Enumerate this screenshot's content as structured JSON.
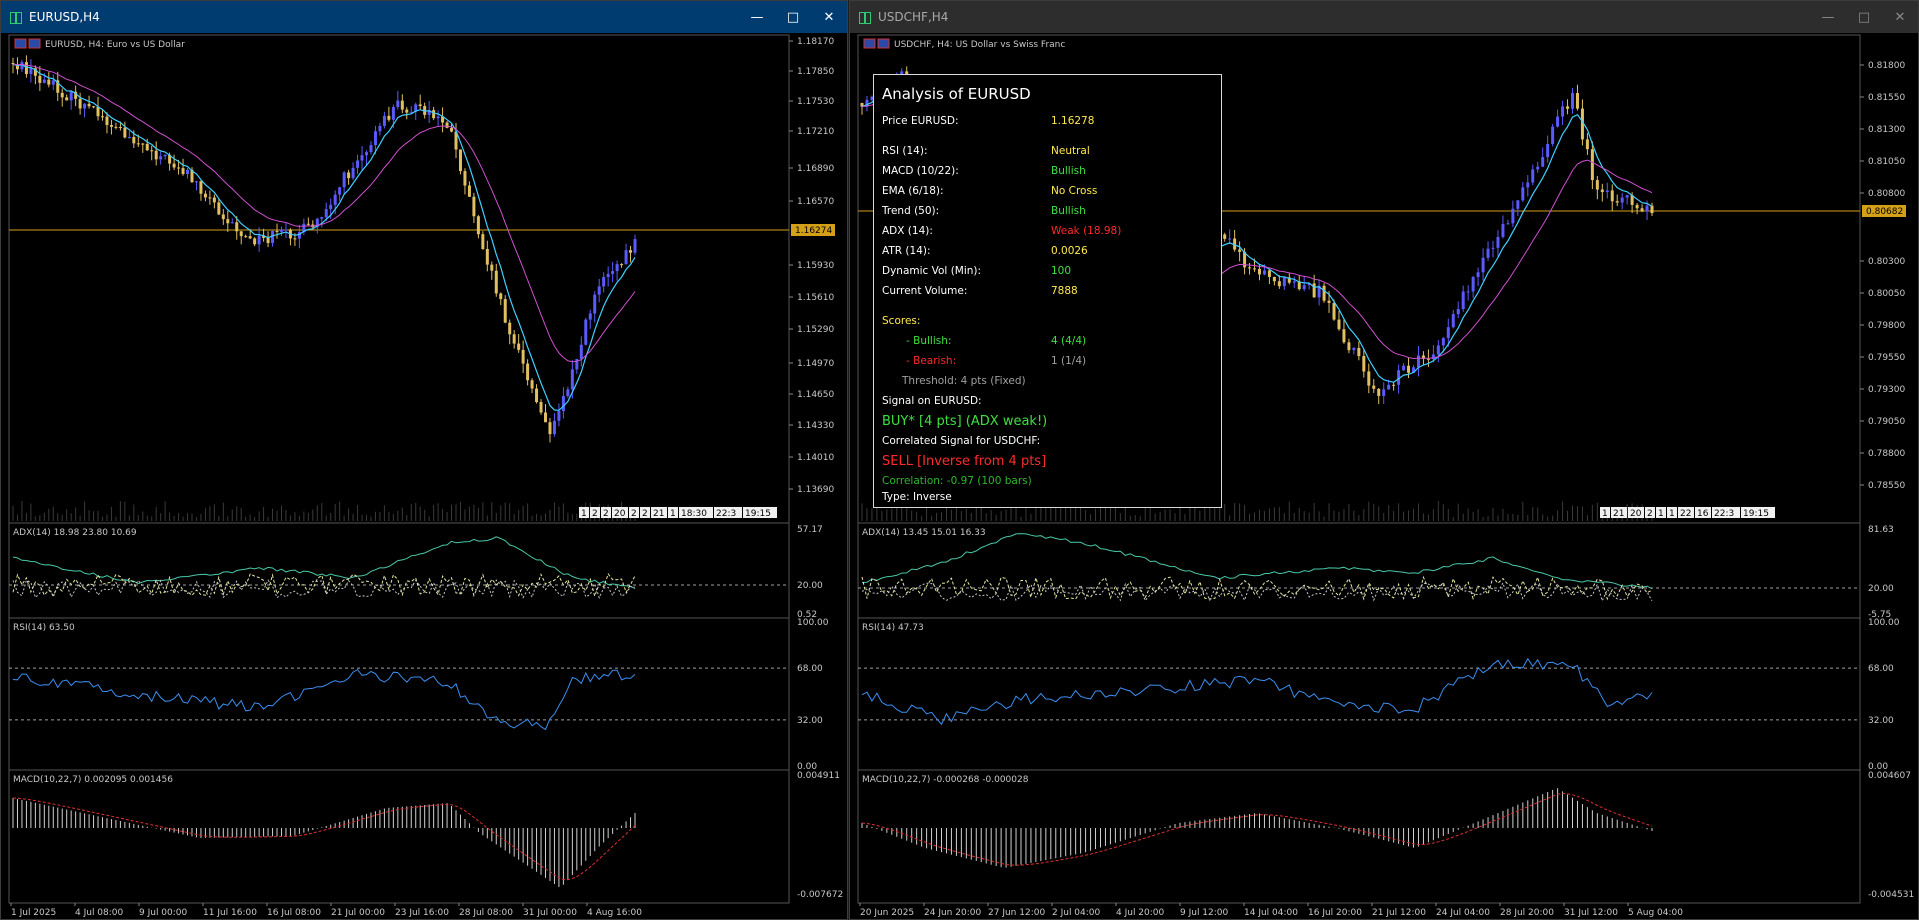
{
  "colors": {
    "bg": "#000000",
    "grid": "#1a1a1a",
    "candle_up": "#5a5aff",
    "candle_down": "#e0c060",
    "ema_fast": "#40d0ff",
    "ema_slow": "#d050d0",
    "price_line": "#d4a017",
    "rsi": "#3b8ff0",
    "adx_main": "#48c8a8",
    "adx_plus": "#e8e8a0",
    "adx_minus": "#c8c8c8",
    "macd_hist": "#d0d0d0",
    "macd_signal": "#e03030",
    "level_line": "#a0a0a0"
  },
  "left": {
    "window_title": "EURUSD,H4",
    "chart_label": "EURUSD, H4:  Euro vs US Dollar",
    "price_ticks": [
      "1.18170",
      "1.17850",
      "1.17530",
      "1.17210",
      "1.16890",
      "1.16570",
      "1.15930",
      "1.15610",
      "1.15290",
      "1.14970",
      "1.14650",
      "1.14330",
      "1.14010",
      "1.13690"
    ],
    "current_price": "1.16274",
    "adx_label": "ADX(14) 18.98 23.80 10.69",
    "adx_ticks": [
      "57.17",
      "20.00",
      "0.52"
    ],
    "rsi_label": "RSI(14) 63.50",
    "rsi_ticks": [
      "100.00",
      "68.00",
      "32.00",
      "0.00"
    ],
    "macd_label": "MACD(10,22,7) 0.002095 0.001456",
    "macd_ticks": [
      "0.004911",
      "-0.007672"
    ],
    "time_ticks": [
      "1 Jul 2025",
      "4 Jul 08:00",
      "9 Jul 00:00",
      "11 Jul 16:00",
      "16 Jul 08:00",
      "21 Jul 00:00",
      "23 Jul 16:00",
      "28 Jul 08:00",
      "31 Jul 00:00",
      "4 Aug 16:00"
    ],
    "vol_tags": [
      "1",
      "2",
      "2",
      "20",
      "2",
      "2",
      "21",
      "1",
      "18:30",
      "22:3",
      "19:15"
    ]
  },
  "right": {
    "window_title": "USDCHF,H4",
    "chart_label": "USDCHF, H4:  US Dollar vs Swiss Franc",
    "price_ticks": [
      "0.81800",
      "0.81550",
      "0.81300",
      "0.81050",
      "0.80800",
      "0.80300",
      "0.80050",
      "0.79800",
      "0.79550",
      "0.79300",
      "0.79050",
      "0.78800",
      "0.78550"
    ],
    "current_price": "0.80682",
    "adx_label": "ADX(14) 13.45 15.01 16.33",
    "adx_ticks": [
      "81.63",
      "20.00",
      "-5.75"
    ],
    "rsi_label": "RSI(14) 47.73",
    "rsi_ticks": [
      "100.00",
      "68.00",
      "32.00",
      "0.00"
    ],
    "macd_label": "MACD(10,22,7) -0.000268 -0.000028",
    "macd_ticks": [
      "0.004607",
      "-0.004531"
    ],
    "time_ticks": [
      "20 Jun 2025",
      "24 Jun 20:00",
      "27 Jun 12:00",
      "2 Jul 04:00",
      "4 Jul 20:00",
      "9 Jul 12:00",
      "14 Jul 04:00",
      "16 Jul 20:00",
      "21 Jul 12:00",
      "24 Jul 04:00",
      "28 Jul 20:00",
      "31 Jul 12:00",
      "5 Aug 04:00"
    ],
    "vol_tags": [
      "1",
      "21",
      "20",
      "2",
      "1",
      "1",
      "22",
      "16",
      "22:3",
      "19:15"
    ]
  },
  "analysis": {
    "title": "Analysis of EURUSD",
    "price_label": "Price EURUSD:",
    "price_value": "1.16278",
    "rows": [
      {
        "label": "RSI (14):",
        "value": "Neutral",
        "color": "yellow"
      },
      {
        "label": "MACD (10/22):",
        "value": "Bullish",
        "color": "green"
      },
      {
        "label": "EMA (6/18):",
        "value": "No Cross",
        "color": "yellow"
      },
      {
        "label": "Trend (50):",
        "value": "Bullish",
        "color": "green"
      },
      {
        "label": "ADX (14):",
        "value": "Weak (18.98)",
        "color": "red"
      },
      {
        "label": "ATR (14):",
        "value": "0.0026",
        "color": "yellow"
      },
      {
        "label": "Dynamic Vol (Min):",
        "value": "100",
        "color": "green"
      },
      {
        "label": "Current Volume:",
        "value": "7888",
        "color": "yellow"
      }
    ],
    "scores_label": "Scores:",
    "bullish_label": "- Bullish:",
    "bullish_value": "4 (4/4)",
    "bearish_label": "- Bearish:",
    "bearish_value": "1 (1/4)",
    "threshold": "Threshold: 4 pts (Fixed)",
    "signal_label": "Signal on EURUSD:",
    "signal_value": "BUY* [4 pts] (ADX weak!)",
    "corr_signal_label": "Correlated Signal for USDCHF:",
    "corr_signal_value": "SELL [Inverse from 4 pts]",
    "correlation": "Correlation: -0.97 (100 bars)",
    "type": "Type: Inverse"
  }
}
